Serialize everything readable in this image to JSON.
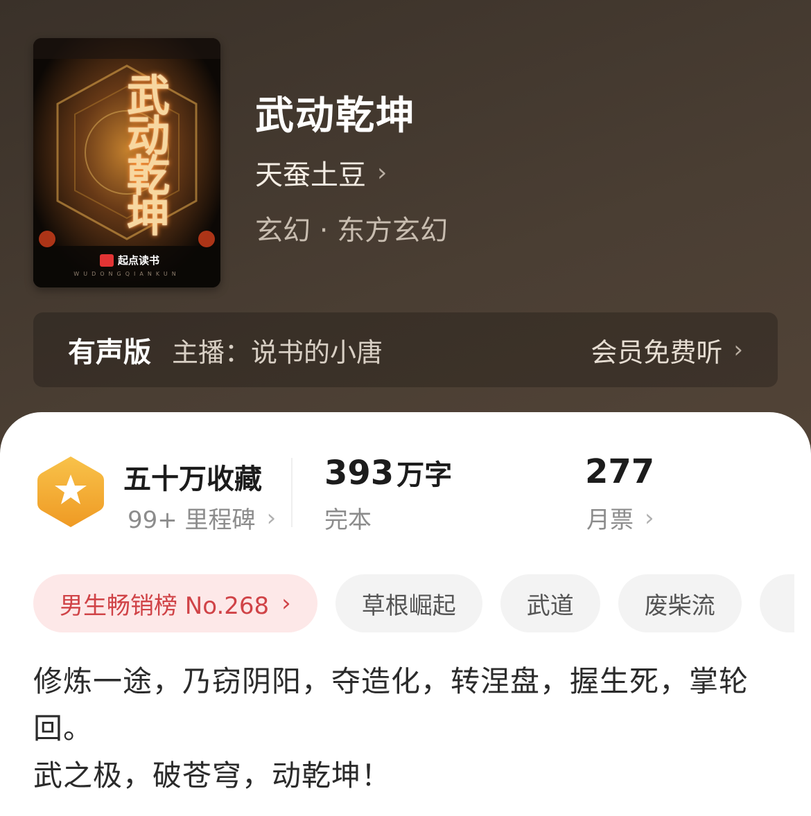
{
  "book": {
    "title": "武动乾坤",
    "author": "天蚕土豆",
    "genre": "玄幻 · 东方玄幻",
    "cover": {
      "title_art": "武动乾坤",
      "publisher": "起点读书",
      "pinyin": "WUDONGQIANKUN"
    }
  },
  "audio": {
    "tag": "有声版",
    "host": "主播：说书的小唐",
    "cta": "会员免费听"
  },
  "stats": {
    "collection": {
      "title": "五十万收藏",
      "sub": "99+ 里程碑"
    },
    "words": {
      "number": "393",
      "unit": "万字",
      "sub": "完本"
    },
    "votes": {
      "number": "277",
      "sub": "月票"
    }
  },
  "tags": [
    {
      "label": "男生畅销榜 No.268",
      "type": "rank"
    },
    {
      "label": "草根崛起",
      "type": "normal"
    },
    {
      "label": "武道",
      "type": "normal"
    },
    {
      "label": "废柴流",
      "type": "normal"
    },
    {
      "label": "",
      "type": "normal"
    }
  ],
  "intro": {
    "line1": "修炼一途，乃窃阴阳，夺造化，转涅盘，握生死，掌轮回。",
    "line2": "武之极，破苍穹，动乾坤！"
  },
  "colors": {
    "header_bg": "#4a3e33",
    "rank_text": "#d04347",
    "rank_bg": "#fde8e8",
    "badge": "#f2a531"
  },
  "icons": {
    "author_chevron": "chevron-right-icon",
    "badge": "star-hexagon-icon"
  }
}
